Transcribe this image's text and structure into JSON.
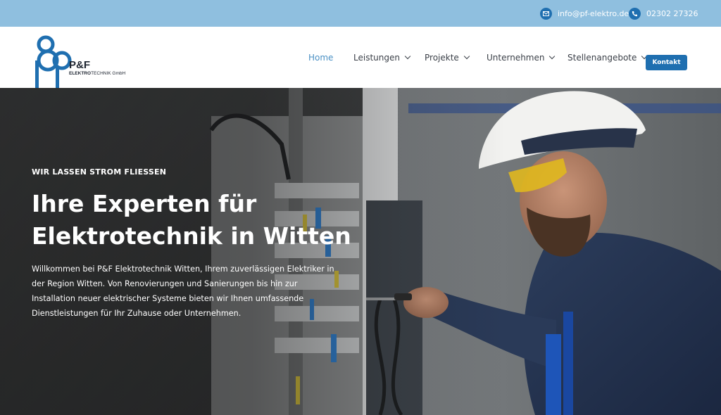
{
  "topbar": {
    "email": "info@pf-elektro.de",
    "phone": "02302 27326",
    "email_icon": "mail-icon",
    "phone_icon": "phone-icon"
  },
  "logo": {
    "name": "P&F",
    "subtitle_bold": "ELEKTRO",
    "subtitle_rest": "TECHNIK GmbH"
  },
  "nav": {
    "items": [
      {
        "label": "Home",
        "active": true
      },
      {
        "label": "Leistungen",
        "dropdown": true
      },
      {
        "label": "Projekte",
        "dropdown": true
      },
      {
        "label": "Unternehmen",
        "dropdown": true
      },
      {
        "label": "Stellenangebote",
        "dropdown": true
      }
    ],
    "cta": "Kontakt"
  },
  "hero": {
    "eyebrow": "WIR LASSEN STROM FLIESSEN",
    "headline_line1": "Ihre Experten für",
    "headline_line2": "Elektrotechnik in Witten",
    "lead": "Willkommen bei P&F Elektrotechnik Witten, Ihrem zuverlässigen Elektriker in der Region Witten. Von Renovierungen und Sanierungen bis hin zur Installation neuer elektrischer Systeme bieten wir Ihnen umfassende Dienstleistungen für Ihr Zuhause oder Unternehmen."
  },
  "colors": {
    "topbar": "#8fbfdf",
    "accent": "#1f6fb0",
    "nav_active": "#4a90c4"
  }
}
